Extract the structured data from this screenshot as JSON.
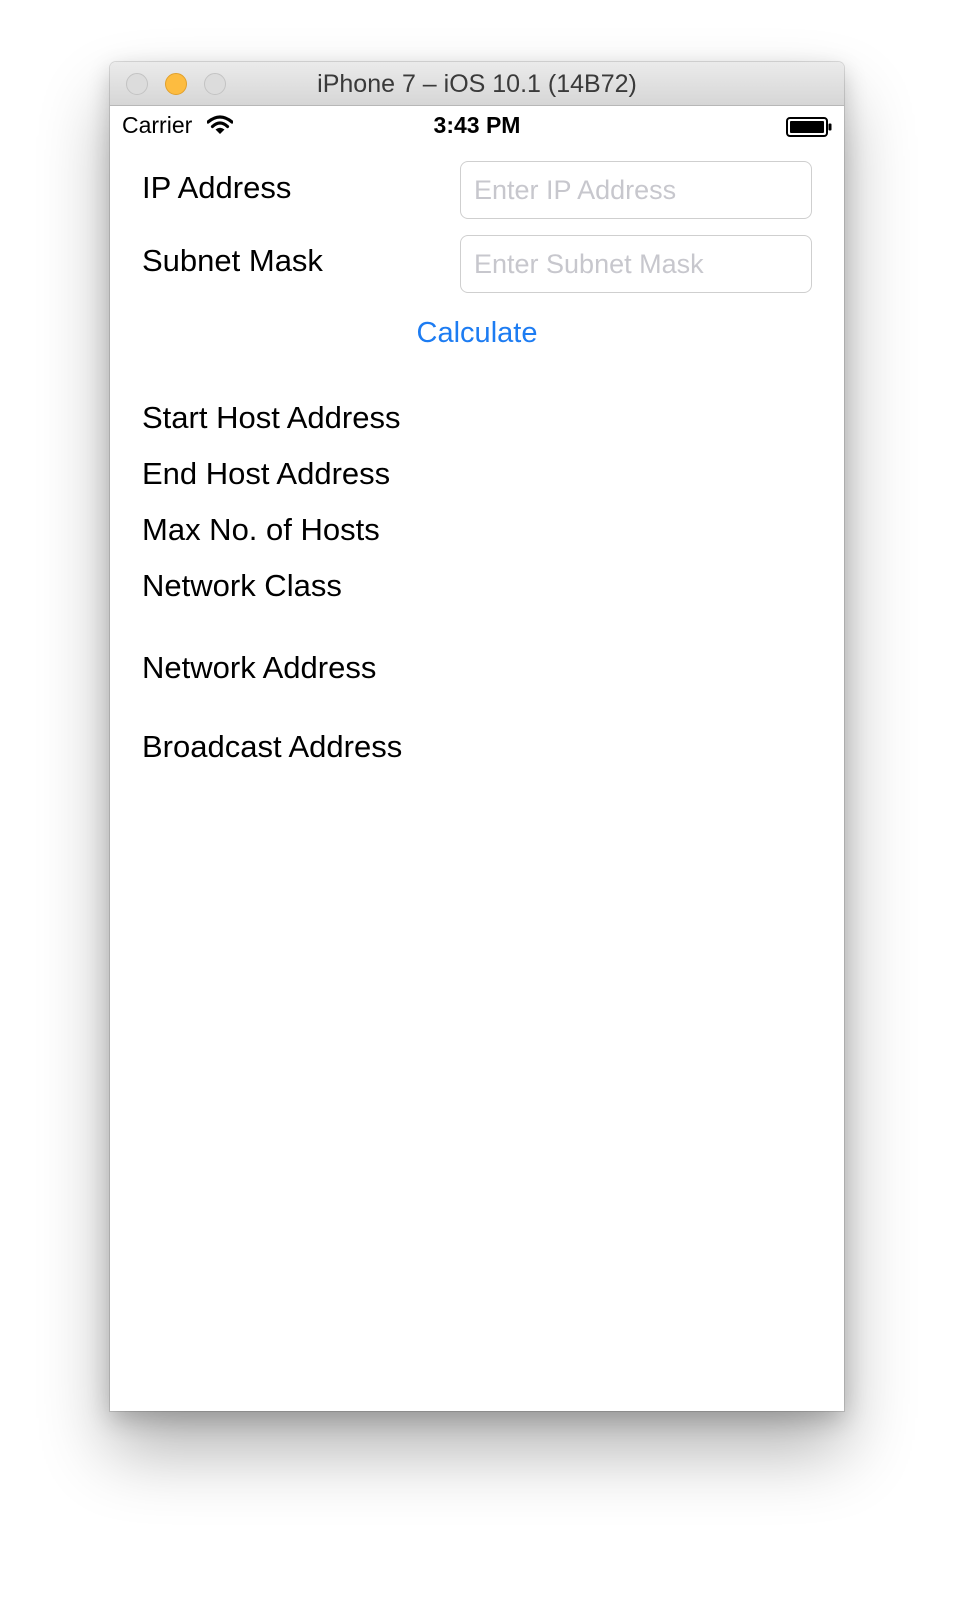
{
  "window": {
    "title": "iPhone 7 – iOS 10.1 (14B72)"
  },
  "status_bar": {
    "carrier": "Carrier",
    "time": "3:43 PM",
    "wifi_icon": "wifi-icon",
    "battery_icon": "battery-icon"
  },
  "form": {
    "ip_label": "IP Address",
    "ip_placeholder": "Enter IP Address",
    "ip_value": "",
    "mask_label": "Subnet Mask",
    "mask_placeholder": "Enter Subnet Mask",
    "mask_value": "",
    "calculate_label": "Calculate"
  },
  "results": {
    "start_host_label": "Start Host Address",
    "end_host_label": "End Host Address",
    "max_hosts_label": "Max No. of Hosts",
    "network_class_label": "Network Class",
    "network_address_label": "Network Address",
    "broadcast_address_label": "Broadcast Address"
  },
  "colors": {
    "accent": "#1d7cf2",
    "placeholder": "#c7c7cd",
    "minimize_button": "#fdbc40"
  }
}
